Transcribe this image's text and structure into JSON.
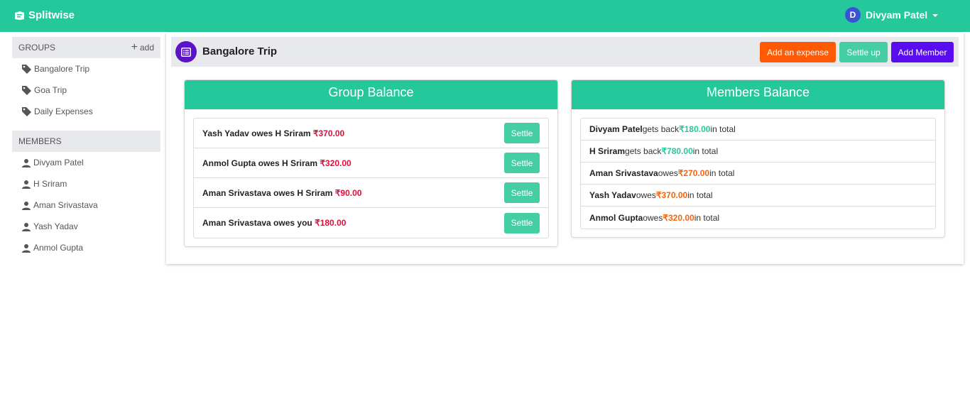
{
  "app": {
    "name": "Splitwise"
  },
  "user": {
    "initial": "D",
    "name": "Divyam Patel"
  },
  "sidebar": {
    "groups_header": "GROUPS",
    "add_label": "add",
    "groups": [
      {
        "label": "Bangalore Trip"
      },
      {
        "label": "Goa Trip"
      },
      {
        "label": "Daily Expenses"
      }
    ],
    "members_header": "MEMBERS",
    "members": [
      {
        "label": "Divyam Patel"
      },
      {
        "label": "H Sriram"
      },
      {
        "label": "Aman Srivastava"
      },
      {
        "label": "Yash Yadav"
      },
      {
        "label": "Anmol Gupta"
      }
    ]
  },
  "group": {
    "title": "Bangalore Trip",
    "add_expense_label": "Add an expense",
    "settle_up_label": "Settle up",
    "add_member_label": "Add Member"
  },
  "group_balance": {
    "title": "Group Balance",
    "settle_label": "Settle",
    "rows": [
      {
        "text": "Yash Yadav owes H Sriram",
        "amount": "₹370.00"
      },
      {
        "text": "Anmol Gupta owes H Sriram",
        "amount": "₹320.00"
      },
      {
        "text": "Aman Srivastava owes H Sriram",
        "amount": "₹90.00"
      },
      {
        "text": "Aman Srivastava owes you",
        "amount": "₹180.00"
      }
    ]
  },
  "members_balance": {
    "title": "Members Balance",
    "rows": [
      {
        "name": "Divyam Patel",
        "verb": "gets back",
        "amount": "₹180.00",
        "suffix": "in total"
      },
      {
        "name": "H Sriram",
        "verb": "gets back",
        "amount": "₹780.00",
        "suffix": "in total"
      },
      {
        "name": "Aman Srivastava",
        "verb": "owes",
        "amount": "₹270.00",
        "suffix": "in total"
      },
      {
        "name": "Yash Yadav",
        "verb": "owes",
        "amount": "₹370.00",
        "suffix": "in total"
      },
      {
        "name": "Anmol Gupta",
        "verb": "owes",
        "amount": "₹320.00",
        "suffix": "in total"
      }
    ]
  },
  "colors": {
    "brand": "#24c89b",
    "expense_button": "#fe5a06",
    "settle_button": "#45cea3",
    "member_button": "#5a0cf0",
    "owe_amount": "#e00d3c",
    "gets_back_amount": "#27c79a",
    "owes_total_amount": "#f26410"
  }
}
